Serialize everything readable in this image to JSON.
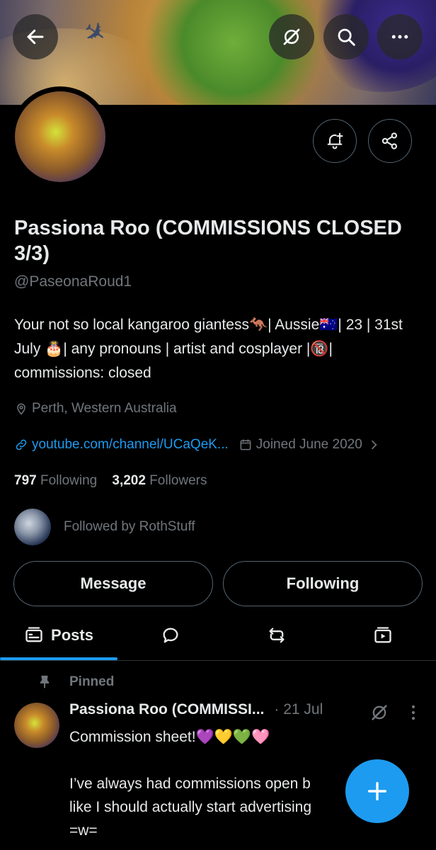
{
  "profile": {
    "name": "Passiona Roo (COMMISSIONS CLOSED 3/3)",
    "handle": "@PaseonaRoud1",
    "bio": "Your not so local kangaroo giantess🦘| Aussie🇦🇺| 23 | 31st July 🎂| any pronouns | artist and cosplayer |🔞| commissions: closed",
    "location": "Perth, Western Australia",
    "website": "youtube.com/channel/UCaQeK...",
    "joined": "Joined June 2020",
    "following_count": "797",
    "following_label": "Following",
    "followers_count": "3,202",
    "followers_label": "Followers",
    "followed_by": "Followed by RothStuff"
  },
  "buttons": {
    "message": "Message",
    "following": "Following"
  },
  "tabs": {
    "posts": "Posts"
  },
  "post": {
    "pinned_label": "Pinned",
    "author": "Passiona Roo (COMMISSI...",
    "date": "· 21 Jul",
    "text": "Commission sheet!💜💛💚🩷\n\nI’ve always had commissions open b\nlike I should actually start advertising\n=w="
  },
  "colors": {
    "accent": "#1d9bf0",
    "background": "#000000",
    "secondary_text": "#71767b"
  }
}
